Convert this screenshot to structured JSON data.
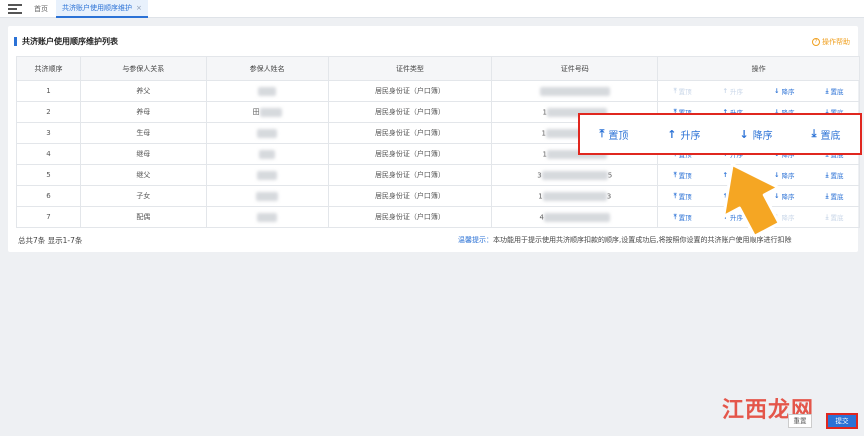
{
  "tabs": {
    "home": "首页",
    "active": "共济账户使用顺序维护",
    "close": "×"
  },
  "panel": {
    "title": "共济账户使用顺序维护列表",
    "help": "操作帮助"
  },
  "table": {
    "headers": [
      "共济顺序",
      "与参保人关系",
      "参保人姓名",
      "证件类型",
      "证件号码",
      "操作"
    ],
    "rows": [
      {
        "order": "1",
        "relation": "养父",
        "name_prefix": "",
        "id_type": "居民身份证（户口簿）",
        "id_prefix": "",
        "id_suffix": ""
      },
      {
        "order": "2",
        "relation": "养母",
        "name_prefix": "田",
        "id_type": "居民身份证（户口簿）",
        "id_prefix": "1",
        "id_suffix": ""
      },
      {
        "order": "3",
        "relation": "生母",
        "name_prefix": "",
        "id_type": "居民身份证（户口簿）",
        "id_prefix": "1",
        "id_suffix": ""
      },
      {
        "order": "4",
        "relation": "继母",
        "name_prefix": "",
        "id_type": "居民身份证（户口簿）",
        "id_prefix": "1",
        "id_suffix": ""
      },
      {
        "order": "5",
        "relation": "继父",
        "name_prefix": "",
        "id_type": "居民身份证（户口簿）",
        "id_prefix": "3",
        "id_suffix": "5"
      },
      {
        "order": "6",
        "relation": "子女",
        "name_prefix": "",
        "id_type": "居民身份证（户口簿）",
        "id_prefix": "1",
        "id_suffix": "3"
      },
      {
        "order": "7",
        "relation": "配偶",
        "name_prefix": "",
        "id_type": "居民身份证（户口簿）",
        "id_prefix": "4",
        "id_suffix": ""
      }
    ],
    "ops": {
      "top": "置顶",
      "up": "升序",
      "down": "降序",
      "bottom": "置底"
    }
  },
  "footer": {
    "count": "总共7条 显示1-7条",
    "tip_label": "温馨提示：",
    "tip_text": "本功能用于提示使用共济顺序扣款的顺序,设置成功后,将按照你设置的共济账户使用顺序进行扣除"
  },
  "callout": {
    "top": "置顶",
    "up": "升序",
    "down": "降序",
    "bottom": "置底"
  },
  "buttons": {
    "reset": "重置",
    "submit": "提交"
  },
  "watermark": {
    "text": "江西龙网",
    "sub": "jx"
  },
  "colors": {
    "accent": "#2b72d6",
    "highlight": "#e0271f",
    "pointer": "#f5a623"
  },
  "icons": {
    "menu": "menu-icon",
    "help": "help-circle-icon",
    "pointer": "cursor-arrow-icon"
  }
}
